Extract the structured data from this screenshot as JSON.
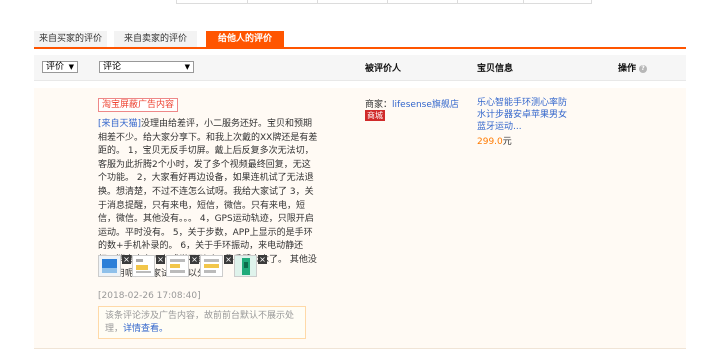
{
  "tabs": [
    {
      "label": "来自买家的评价"
    },
    {
      "label": "来自卖家的评价"
    },
    {
      "label": "给他人的评价"
    }
  ],
  "header": {
    "rating_filter": "评价",
    "comment_filter": "评论",
    "col_rated": "被评价人",
    "col_item": "宝贝信息",
    "col_action": "操作"
  },
  "review": {
    "ad_tag": "淘宝屏蔽广告内容",
    "source": "[来自天猫]",
    "text": "没理由给差评，小二服务还好。宝贝和预期相差不少。给大家分享下。和我上次戴的XX牌还是有差距的。 1，宝贝无反手切屏。戴上后反复多次无法切，客服为此折腾2个小时，发了多个视频最终回复，无这个功能。 2，大家看好再边设备，如果连机试了无法退换。想清楚，不过不连怎么试呀。我给大家试了 3，关于消息提醒，只有来电，短信，微信。只有来电，短信，微信。其他没有。。。 4，GPS运动轨迹，只限开启运动。平时没有。 5，关于步数，APP上显示的是手环的数+手机补录的。 6，关于手环振动，来电动静还行，消息十有八九感觉不到时。我手臂太木了。 其他没有试用呢，大家试了可以分享。",
    "date": "[2018-02-26 17:08:40]",
    "notice_text": "该条评论涉及广告内容，故前前台默认不展示处理，",
    "notice_link": "详情查看。"
  },
  "seller": {
    "label": "商家：",
    "name": "lifesense旗舰店",
    "badge": "商城"
  },
  "item": {
    "title": "乐心智能手环测心率防水计步器安卓苹果男女蓝牙运动...",
    "price": "299.0",
    "currency": "元"
  },
  "colors": {
    "accent": "#ff5500",
    "link": "#3366cc",
    "price": "#ff7a00"
  }
}
